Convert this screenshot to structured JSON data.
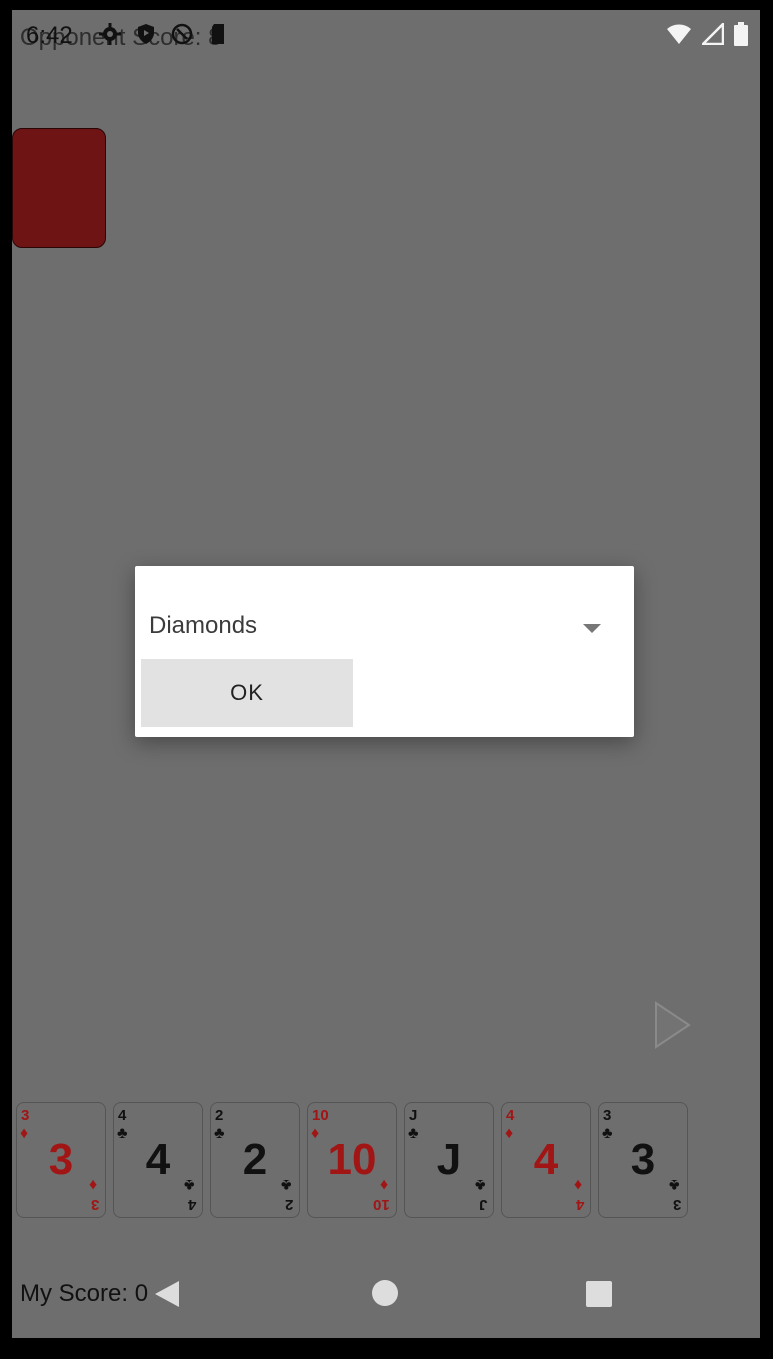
{
  "status_bar": {
    "time": "6:42",
    "left_icons": [
      "gear-icon",
      "shield-icon",
      "sync-icon",
      "sdcard-icon"
    ],
    "right_icons": [
      "wifi-icon",
      "signal-icon",
      "battery-icon"
    ]
  },
  "game": {
    "opponent_score_label": "Opponent Score: 8",
    "my_score_label": "My Score: 0",
    "opponent_deck_color": "#6e1414",
    "hand": [
      {
        "rank": "3",
        "suit": "♦",
        "color": "red"
      },
      {
        "rank": "4",
        "suit": "♣",
        "color": "black"
      },
      {
        "rank": "2",
        "suit": "♣",
        "color": "black"
      },
      {
        "rank": "10",
        "suit": "♦",
        "color": "red"
      },
      {
        "rank": "J",
        "suit": "♣",
        "color": "black"
      },
      {
        "rank": "4",
        "suit": "♦",
        "color": "red"
      },
      {
        "rank": "3",
        "suit": "♣",
        "color": "black"
      }
    ]
  },
  "dialog": {
    "selected_suit": "Diamonds",
    "ok_label": "OK"
  },
  "nav_bar": {
    "icons": [
      "back-icon",
      "home-icon",
      "recents-icon"
    ]
  }
}
